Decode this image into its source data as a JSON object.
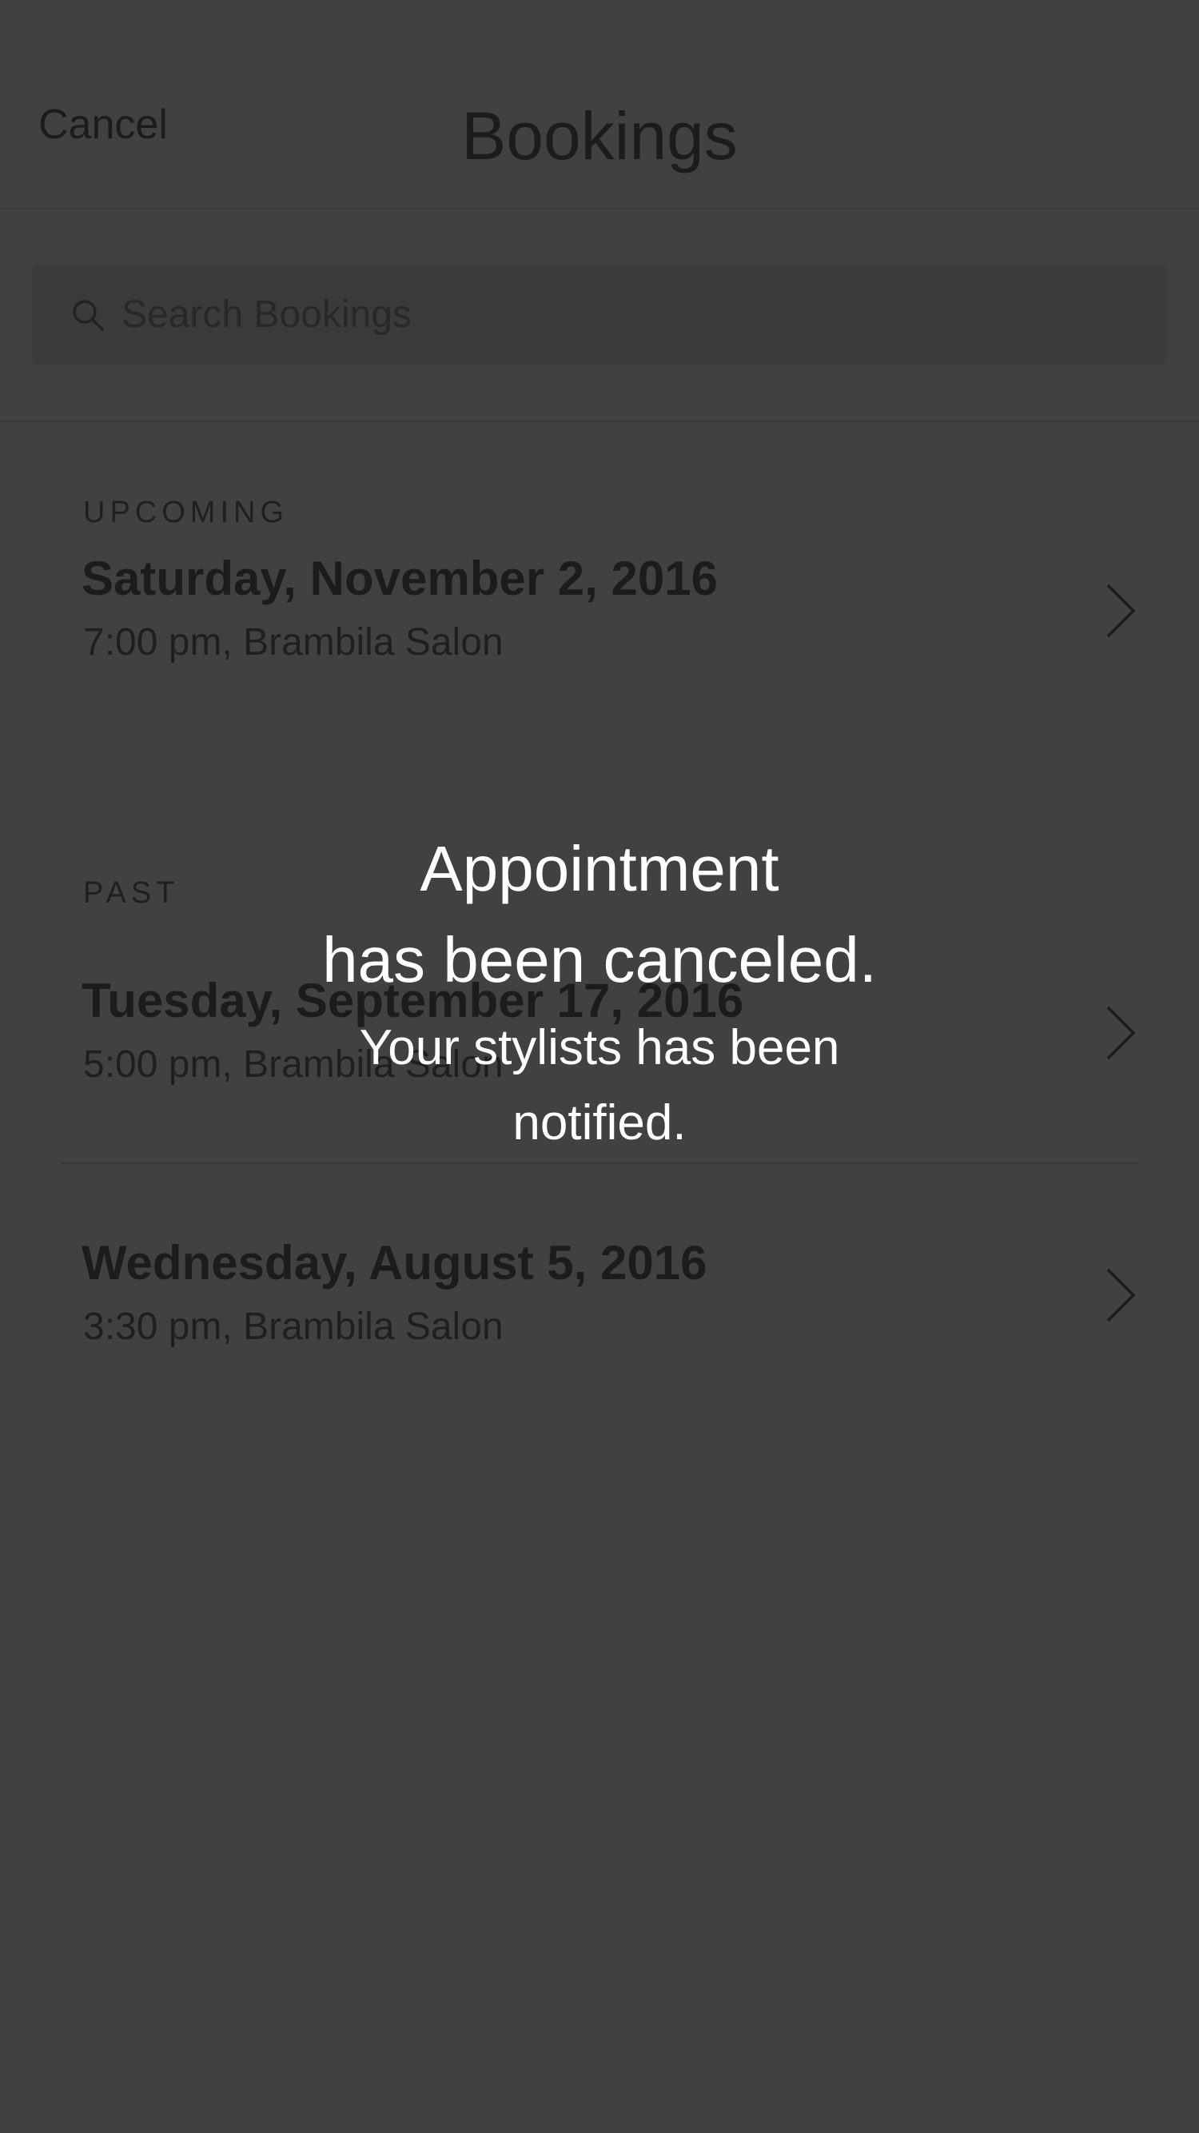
{
  "header": {
    "cancel_label": "Cancel",
    "title": "Bookings"
  },
  "search": {
    "placeholder": "Search Bookings",
    "value": ""
  },
  "sections": {
    "upcoming_label": "UPCOMING",
    "past_label": "PAST"
  },
  "bookings": [
    {
      "date": "Saturday, November 2, 2016",
      "detail": "7:00 pm, Brambila Salon",
      "section": "upcoming"
    },
    {
      "date": "Tuesday, September 17, 2016",
      "detail": "5:00 pm, Brambila Salon",
      "section": "past"
    },
    {
      "date": "Wednesday, August 5, 2016",
      "detail": "3:30 pm, Brambila Salon",
      "section": "past"
    }
  ],
  "toast": {
    "title_line1": "Appointment",
    "title_line2": "has been canceled.",
    "message": "Your stylists has been notified."
  },
  "icons": {
    "search": "search-icon",
    "chevron": "chevron-right-icon"
  },
  "colors": {
    "background": "#414141",
    "text_dark": "#1c1c1c",
    "toast_text": "#ffffff"
  }
}
